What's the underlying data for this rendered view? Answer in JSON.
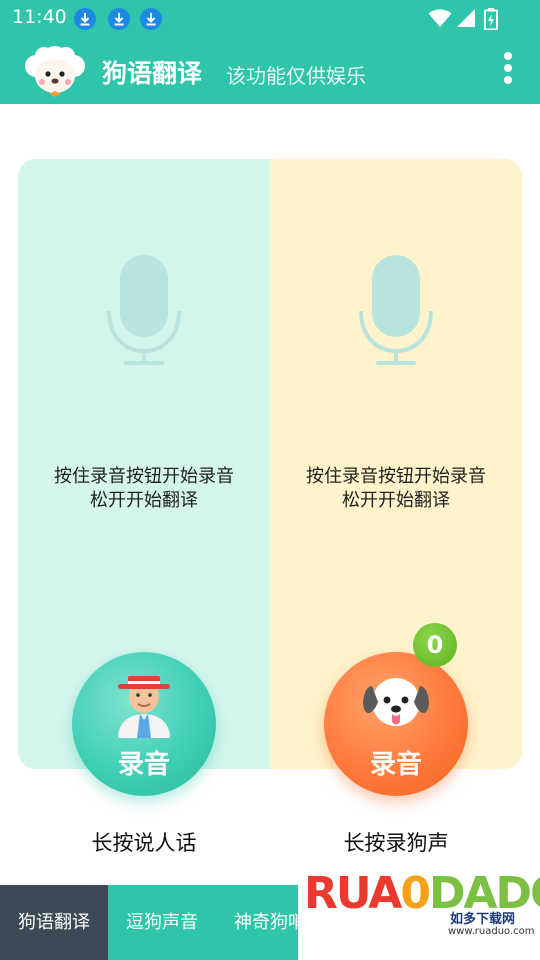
{
  "status_bar": {
    "time": "11:40",
    "download_icons": 3,
    "icons": [
      "download-icon",
      "wifi-icon",
      "signal-icon",
      "battery-icon"
    ]
  },
  "app_bar": {
    "title": "狗语翻译",
    "subtitle": "该功能仅供娱乐",
    "menu_icon": "more-vert-icon",
    "color": "#2ec5ab"
  },
  "panels": {
    "left": {
      "hint_line1": "按住录音按钮开始录音",
      "hint_line2": "松开开始翻译",
      "bg": "#d4f5ec"
    },
    "right": {
      "hint_line1": "按住录音按钮开始录音",
      "hint_line2": "松开开始翻译",
      "bg": "#fff3cc"
    }
  },
  "record_buttons": {
    "human": {
      "label": "录音",
      "caption": "长按说人话",
      "icon": "man-avatar-icon"
    },
    "dog": {
      "label": "录音",
      "caption": "长按录狗声",
      "icon": "dog-face-icon",
      "badge": "0"
    }
  },
  "tabs": [
    {
      "label": "狗语翻译",
      "active": true
    },
    {
      "label": "逗狗声音",
      "active": false
    },
    {
      "label": "神奇狗哨",
      "active": false
    }
  ],
  "watermark": {
    "logo_text_1": "RUA",
    "logo_text_2": "0",
    "logo_text_3": "DADO",
    "site_name": "如多下载网",
    "url": "www.ruaduo.com"
  }
}
